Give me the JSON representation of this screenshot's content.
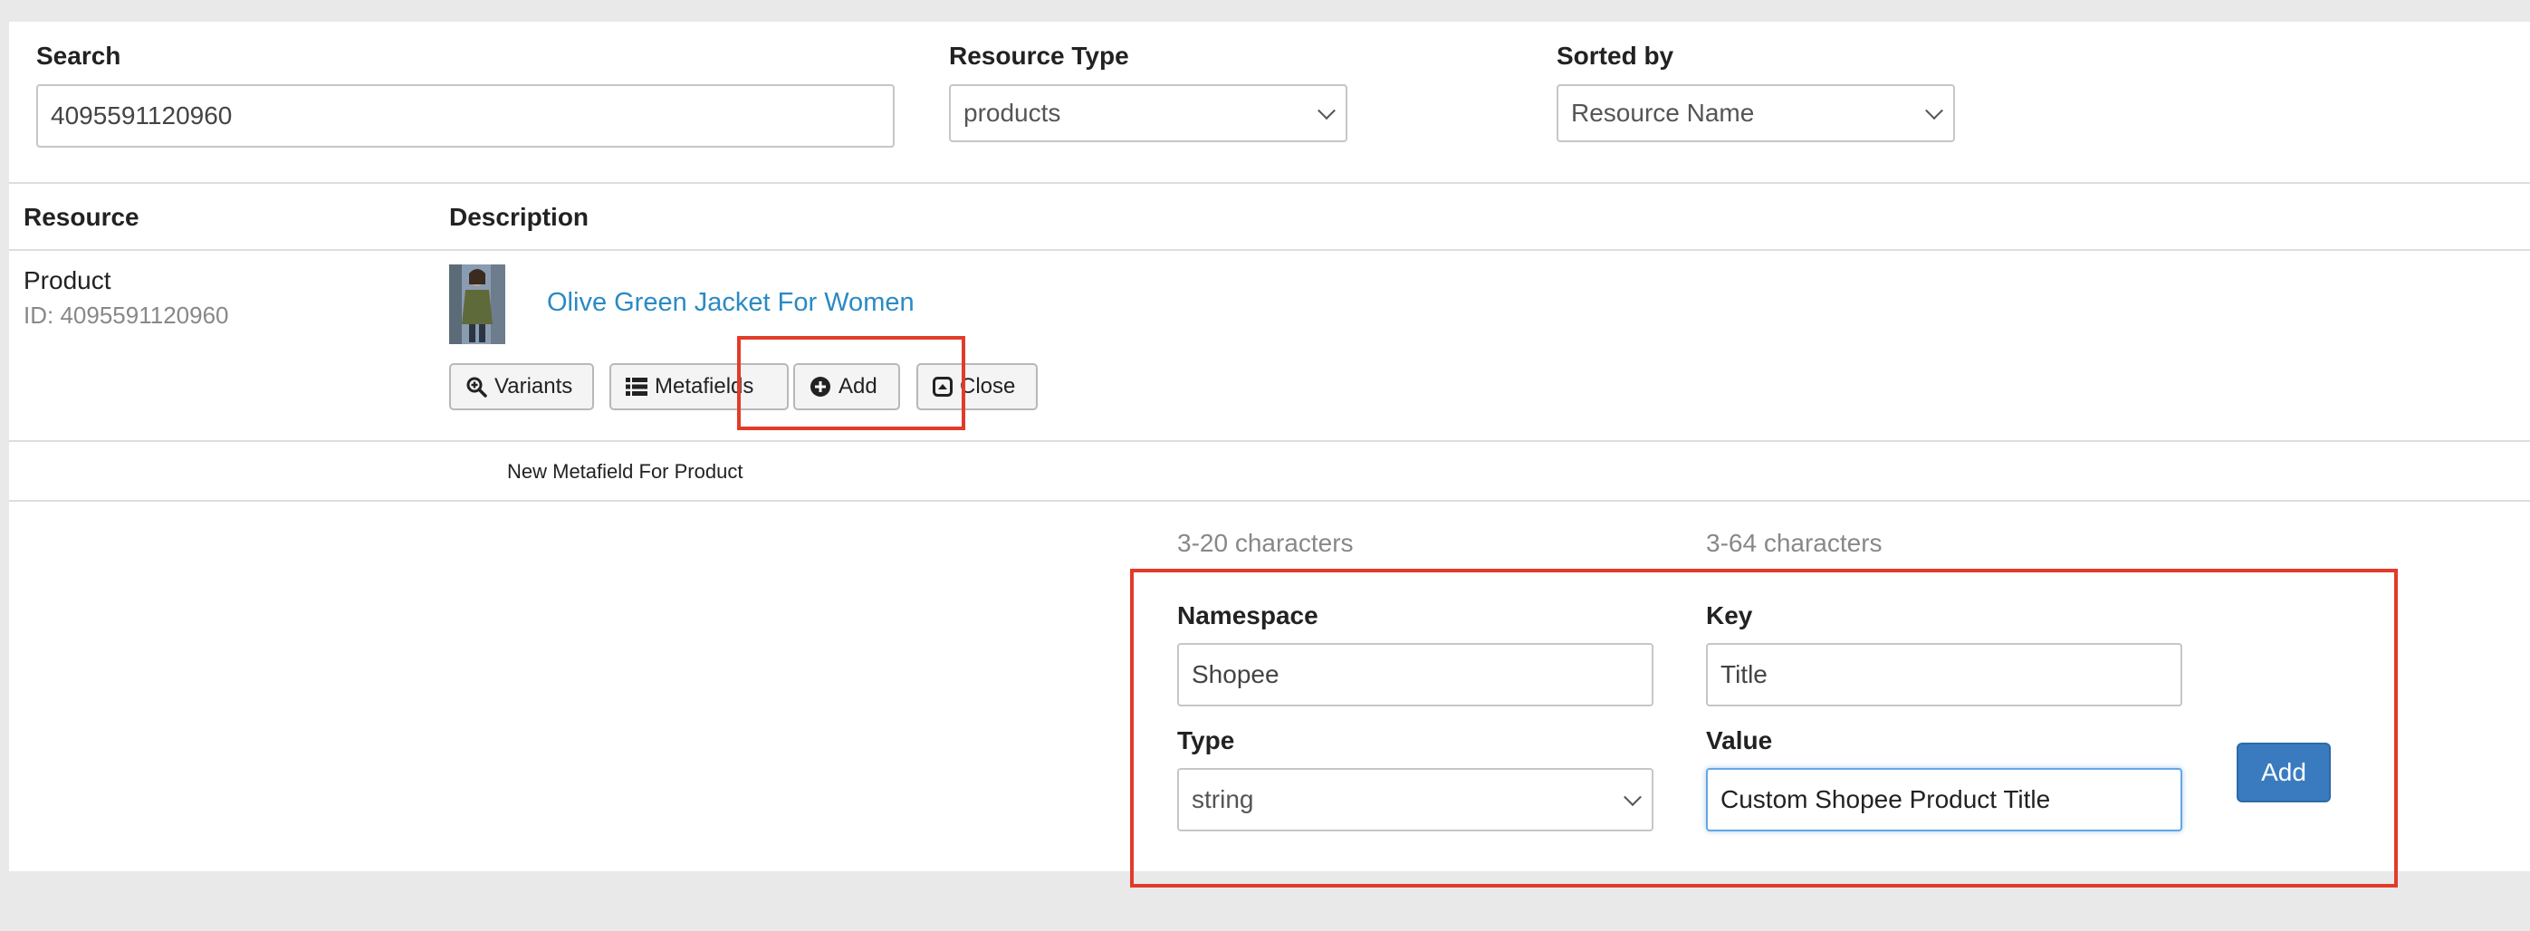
{
  "filters": {
    "search_label": "Search",
    "search_value": "4095591120960",
    "resource_type_label": "Resource Type",
    "resource_type_value": "products",
    "sorted_by_label": "Sorted by",
    "sorted_by_value": "Resource Name"
  },
  "table": {
    "col_resource": "Resource",
    "col_description": "Description"
  },
  "row": {
    "resource_type": "Product",
    "resource_id": "ID: 4095591120960",
    "product_title": "Olive Green Jacket For Women",
    "buttons": {
      "variants": "Variants",
      "metafields": "Metafields",
      "add": "Add",
      "close": "Close"
    }
  },
  "new_metafield": {
    "heading": "New Metafield For Product",
    "namespace_hint": "3-20 characters",
    "key_hint": "3-64 characters",
    "namespace_label": "Namespace",
    "namespace_value": "Shopee",
    "key_label": "Key",
    "key_value": "Title",
    "type_label": "Type",
    "type_value": "string",
    "value_label": "Value",
    "value_value": "Custom Shopee Product Title",
    "add_button": "Add"
  },
  "icons": {
    "variants": "magnifier-plus-icon",
    "metafields": "list-icon",
    "add": "plus-circle-icon",
    "close": "collapse-up-icon"
  },
  "colors": {
    "link": "#2a8ac4",
    "primary_button": "#3a7bbf",
    "highlight": "#e23b2a"
  }
}
